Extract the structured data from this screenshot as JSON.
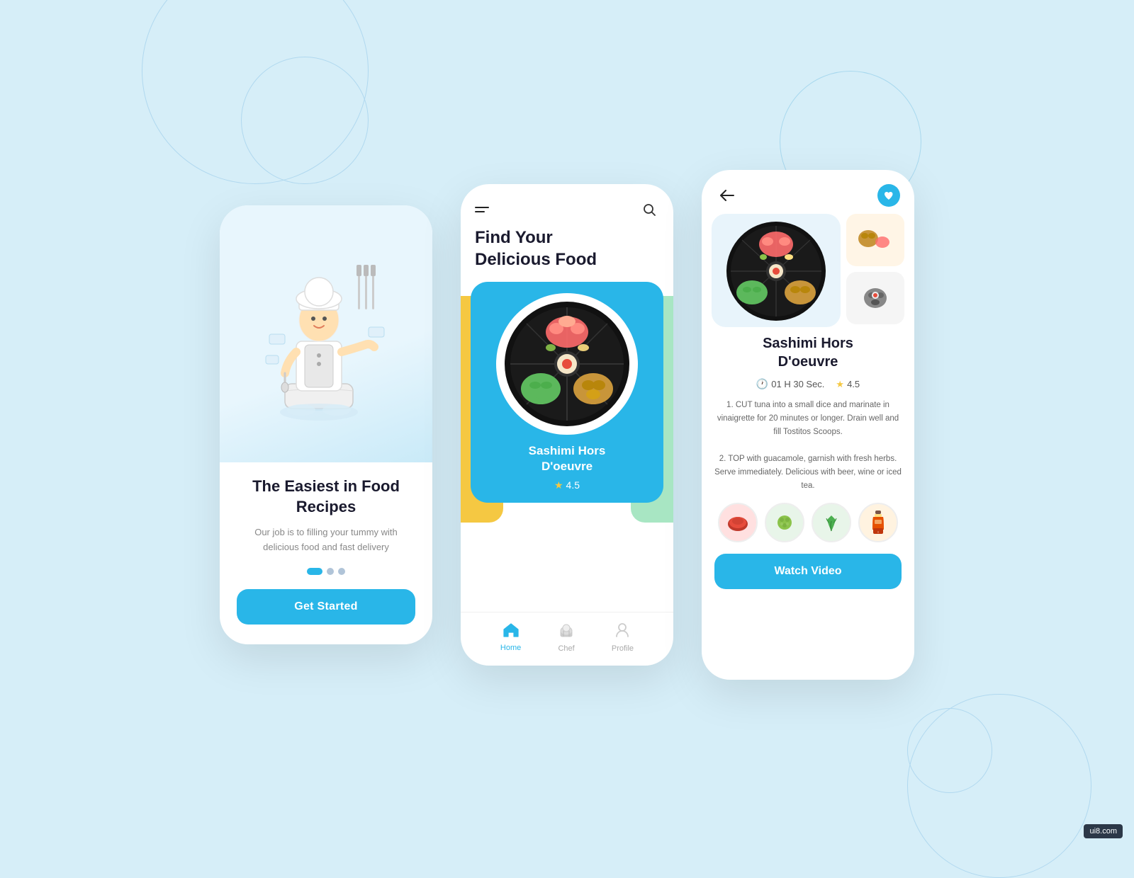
{
  "background": {
    "color": "#d6eef8"
  },
  "phone1": {
    "title": "The Easiest in\nFood Recipes",
    "subtitle": "Our job is to filling your tummy with\ndelicious food and fast delivery",
    "dots": [
      "active",
      "inactive",
      "inactive"
    ],
    "cta_label": "Get Started"
  },
  "phone2": {
    "heading_line1": "Find Your",
    "heading_line2": "Delicious Food",
    "food_card": {
      "name_line1": "Sashimi Hors",
      "name_line2": "D'oeuvre",
      "rating": "4.5"
    },
    "nav_items": [
      {
        "label": "Home",
        "icon": "🏠",
        "active": true
      },
      {
        "label": "Chef",
        "icon": "👨‍🍳",
        "active": false
      },
      {
        "label": "Profile",
        "icon": "👤",
        "active": false
      }
    ]
  },
  "phone3": {
    "dish_title_line1": "Sashimi Hors",
    "dish_title_line2": "D'oeuvre",
    "time": "01 H 30 Sec.",
    "rating": "4.5",
    "description_step1": "1. CUT tuna into a small dice and marinate in vinaigrette for 20 minutes or longer. Drain well and fill Tostitos Scoops.",
    "description_step2": "2. TOP with guacamole, garnish with fresh herbs. Serve immediately. Delicious with beer, wine or iced tea.",
    "ingredients": [
      "🥩",
      "🌿",
      "🌱",
      "🍺"
    ],
    "watch_video_label": "Watch Video"
  },
  "watermark": "ui8.com"
}
